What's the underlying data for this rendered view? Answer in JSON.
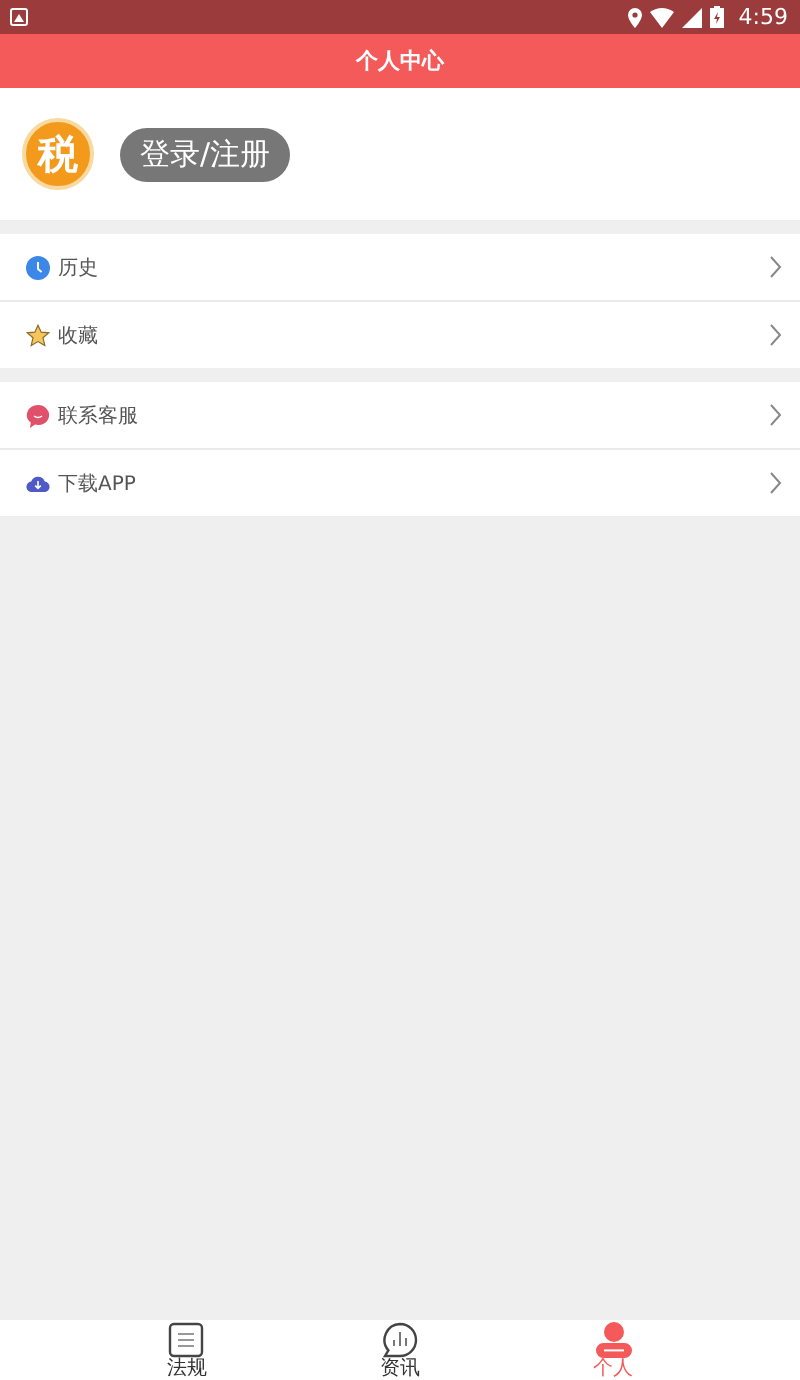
{
  "status_bar": {
    "time": "4:59"
  },
  "header": {
    "title": "个人中心"
  },
  "profile": {
    "logo": "税",
    "login_button": "登录/注册"
  },
  "menu_groups": [
    [
      {
        "kind": "clock",
        "label": "历史"
      },
      {
        "kind": "star",
        "label": "收藏"
      }
    ],
    [
      {
        "kind": "chat",
        "label": "联系客服"
      },
      {
        "kind": "cloud",
        "label": "下载APP"
      }
    ]
  ],
  "tabs": [
    {
      "kind": "doc",
      "label": "法规",
      "selected": false
    },
    {
      "kind": "news",
      "label": "资讯",
      "selected": false
    },
    {
      "kind": "person",
      "label": "个人",
      "selected": true
    }
  ]
}
